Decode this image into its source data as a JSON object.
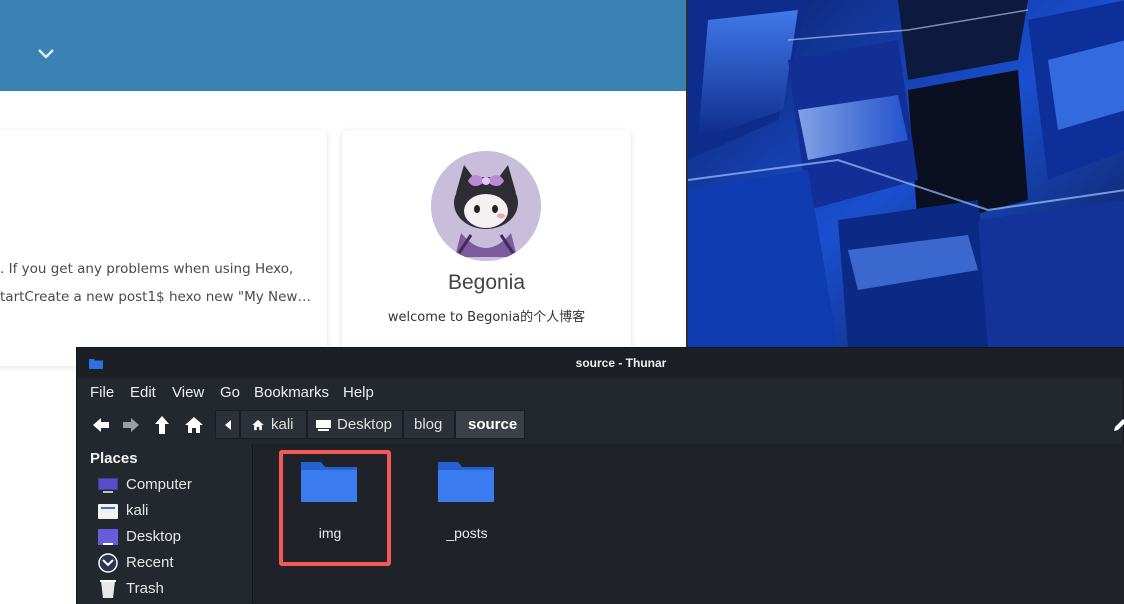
{
  "blog": {
    "post_excerpt_line1": ". If you get any problems when using Hexo,",
    "post_excerpt_line2": "tartCreate a new post1$ hexo new \"My New…",
    "author_name": "Begonia",
    "author_bio": "welcome to Begonia的个人博客",
    "header_color": "#3a82b4"
  },
  "window": {
    "title": "source - Thunar"
  },
  "menu": [
    "File",
    "Edit",
    "View",
    "Go",
    "Bookmarks",
    "Help"
  ],
  "pathbar": {
    "crumbs": [
      "kali",
      "Desktop",
      "blog",
      "source"
    ],
    "active": "source"
  },
  "sidebar": {
    "header": "Places",
    "items": [
      {
        "label": "Computer",
        "icon": "computer-icon"
      },
      {
        "label": "kali",
        "icon": "home-folder-icon"
      },
      {
        "label": "Desktop",
        "icon": "desktop-icon"
      },
      {
        "label": "Recent",
        "icon": "recent-icon"
      },
      {
        "label": "Trash",
        "icon": "trash-icon"
      }
    ]
  },
  "files": [
    {
      "name": "img",
      "icon": "folder-icon",
      "highlighted": true
    },
    {
      "name": "_posts",
      "icon": "folder-icon",
      "highlighted": false
    }
  ],
  "colors": {
    "folder": "#2f6fe0",
    "highlight": "#f25a5a",
    "window_bg": "#23272e"
  }
}
